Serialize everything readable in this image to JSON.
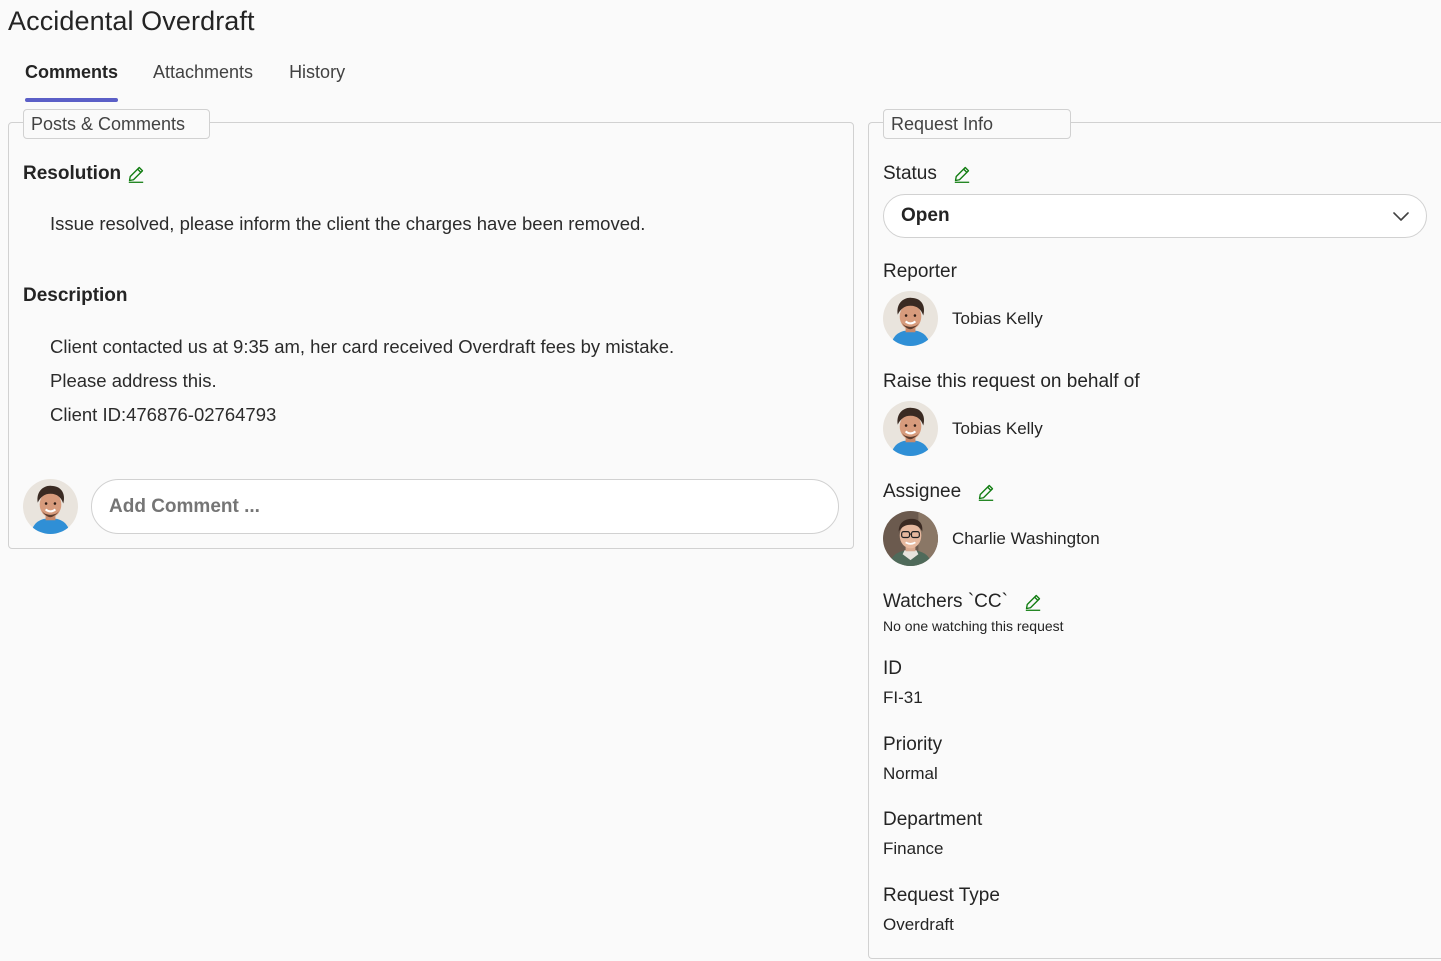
{
  "page": {
    "title": "Accidental Overdraft"
  },
  "tabs": [
    {
      "label": "Comments",
      "active": true
    },
    {
      "label": "Attachments",
      "active": false
    },
    {
      "label": "History",
      "active": false
    }
  ],
  "posts": {
    "legend": "Posts & Comments",
    "resolution_label": "Resolution",
    "resolution_text": "Issue resolved, please inform the client the charges have been removed.",
    "description_label": "Description",
    "description_lines": [
      "Client contacted us at 9:35 am, her card received Overdraft fees by mistake.",
      "Please address this.",
      "Client ID:476876-02764793"
    ],
    "comment_placeholder": "Add Comment ..."
  },
  "info": {
    "legend": "Request Info",
    "status_label": "Status",
    "status_value": "Open",
    "reporter_label": "Reporter",
    "reporter_name": "Tobias Kelly",
    "behalf_label": "Raise this request on behalf of",
    "behalf_name": "Tobias Kelly",
    "assignee_label": "Assignee",
    "assignee_name": "Charlie Washington",
    "watchers_label": "Watchers `CC`",
    "watchers_text": "No one watching this request",
    "id_label": "ID",
    "id_value": "FI-31",
    "priority_label": "Priority",
    "priority_value": "Normal",
    "department_label": "Department",
    "department_value": "Finance",
    "request_type_label": "Request Type",
    "request_type_value": "Overdraft"
  },
  "colors": {
    "accent": "#5b5fc7",
    "edit_icon": "#107c10",
    "border": "#d1d1d1"
  },
  "icons": [
    "pencil-icon",
    "chevron-down-icon",
    "avatar"
  ]
}
